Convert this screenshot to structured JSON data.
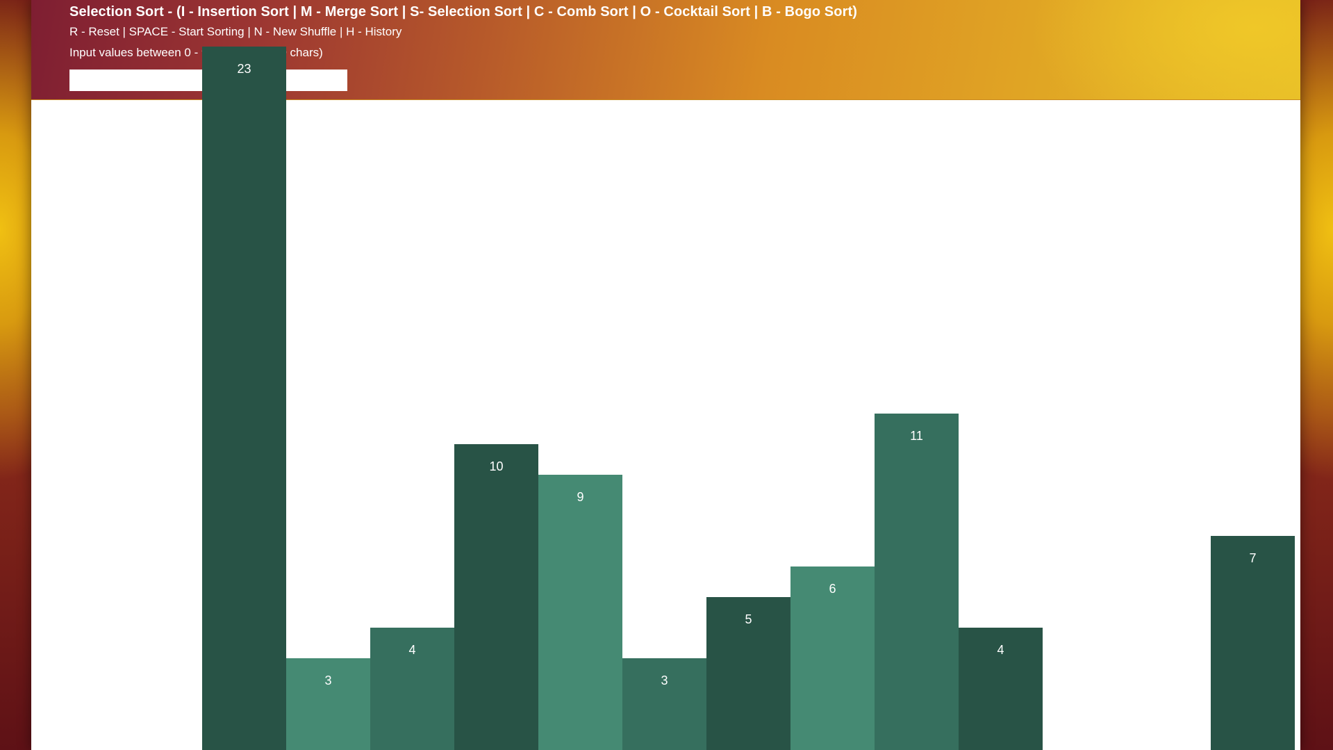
{
  "header": {
    "title": "Selection Sort - (I - Insertion Sort | M - Merge Sort | S- Selection Sort | C - Comb Sort | O - Cocktail Sort | B - Bogo Sort)",
    "controls": "R - Reset | SPACE - Start Sorting | N - New Shuffle | H - History",
    "input_hint": "Input values between 0 - 900 (max of 100 chars)"
  },
  "input": {
    "value": "",
    "placeholder": ""
  },
  "colors": {
    "dark": "#285346",
    "mid": "#366f5e",
    "light": "#458a73"
  },
  "chart_data": {
    "type": "bar",
    "values": [
      null,
      null,
      23,
      3,
      4,
      10,
      9,
      3,
      5,
      6,
      11,
      4,
      null,
      null,
      7
    ],
    "labels": [
      "",
      "",
      "23",
      "3",
      "4",
      "10",
      "9",
      "3",
      "5",
      "6",
      "11",
      "4",
      "",
      "",
      "7"
    ],
    "shades": [
      "",
      "",
      "dark",
      "light",
      "mid",
      "dark",
      "light",
      "mid",
      "dark",
      "light",
      "mid",
      "dark",
      "",
      "",
      "dark"
    ]
  }
}
